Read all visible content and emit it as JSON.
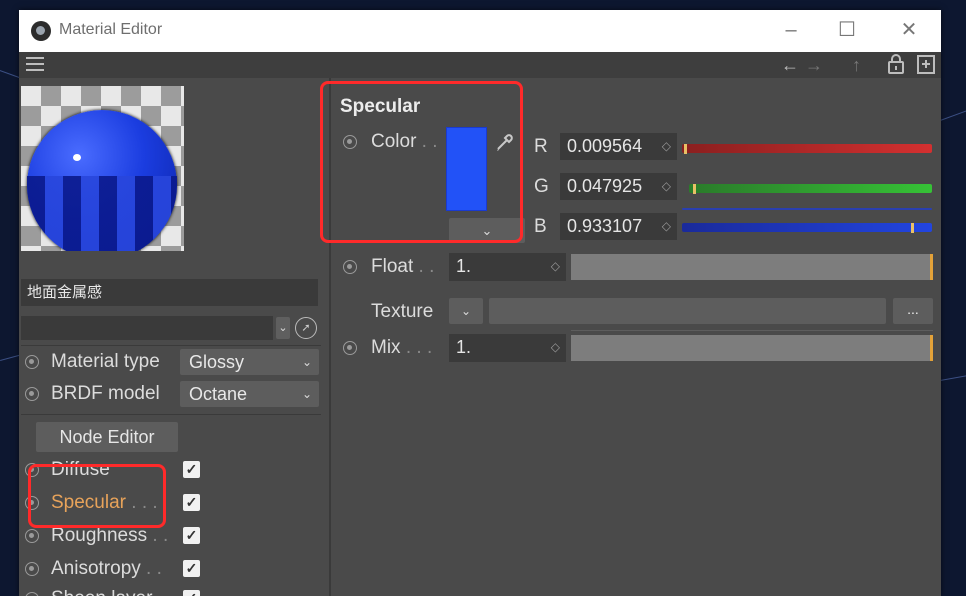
{
  "window": {
    "title": "Material Editor",
    "controls": {
      "minimize": "–",
      "maximize": "☐",
      "close": "✕"
    }
  },
  "toolbar": {
    "menu_icon": "hamburger-icon",
    "icons": [
      "back-arrow-icon",
      "forward-arrow-icon",
      "up-arrow-icon",
      "lock-icon",
      "new-window-icon"
    ]
  },
  "left_panel": {
    "material_name": "地面金属感",
    "material_type": {
      "label": "Material type",
      "value": "Glossy"
    },
    "brdf_model": {
      "label": "BRDF model",
      "value": "Octane"
    },
    "node_editor_label": "Node Editor",
    "channels": [
      {
        "label": "Diffuse",
        "checked": true
      },
      {
        "label": "Specular",
        "checked": true,
        "active": true
      },
      {
        "label": "Roughness",
        "checked": true
      },
      {
        "label": "Anisotropy",
        "checked": true
      },
      {
        "label": "Sheen layer",
        "checked": true
      }
    ]
  },
  "specular": {
    "title": "Specular",
    "color_label": "Color",
    "swatch_color": "#2252f7",
    "r": {
      "label": "R",
      "value": "0.009564"
    },
    "g": {
      "label": "G",
      "value": "0.047925"
    },
    "b": {
      "label": "B",
      "value": "0.933107"
    },
    "float": {
      "label": "Float",
      "value": "1."
    },
    "texture_label": "Texture",
    "texture_button": "...",
    "mix": {
      "label": "Mix",
      "value": "1."
    }
  },
  "colors": {
    "highlight_box": "#ff2a2a",
    "active_channel": "#e8a35a"
  }
}
